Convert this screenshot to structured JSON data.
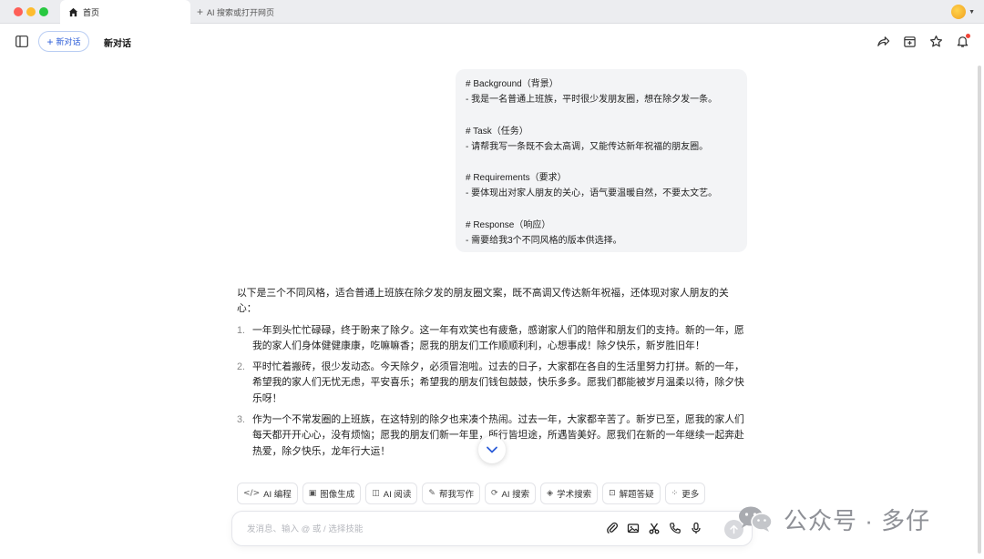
{
  "window": {
    "tabs": [
      {
        "label": "首页",
        "active": true
      },
      {
        "label": "AI 搜索或打开网页",
        "active": false
      }
    ]
  },
  "header": {
    "new_chat_label": "新对话",
    "title": "新对话"
  },
  "user_message": {
    "lines": [
      "# Background（背景）",
      "- 我是一名普通上班族，平时很少发朋友圈，想在除夕发一条。",
      "",
      "# Task（任务）",
      "- 请帮我写一条既不会太高调，又能传达新年祝福的朋友圈。",
      "",
      "# Requirements（要求）",
      "- 要体现出对家人朋友的关心，语气要温暖自然，不要太文艺。",
      "",
      "# Response（响应）",
      "- 需要给我3个不同风格的版本供选择。"
    ]
  },
  "answer": {
    "intro": "以下是三个不同风格，适合普通上班族在除夕发的朋友圈文案，既不高调又传达新年祝福，还体现对家人朋友的关心：",
    "items": [
      {
        "num": "1.",
        "text": "一年到头忙忙碌碌，终于盼来了除夕。这一年有欢笑也有疲惫，感谢家人们的陪伴和朋友们的支持。新的一年，愿我的家人们身体健健康康，吃嘛嘛香；愿我的朋友们工作顺顺利利，心想事成！除夕快乐，新岁胜旧年！"
      },
      {
        "num": "2.",
        "text": "平时忙着搬砖，很少发动态。今天除夕，必须冒泡啦。过去的日子，大家都在各自的生活里努力打拼。新的一年，希望我的家人们无忧无虑，平安喜乐；希望我的朋友们钱包鼓鼓，快乐多多。愿我们都能被岁月温柔以待，除夕快乐呀！"
      },
      {
        "num": "3.",
        "text": "作为一个不常发圈的上班族，在这特别的除夕也来凑个热闹。过去一年，大家都辛苦了。新岁已至，愿我的家人们每天都开开心心，没有烦恼；愿我的朋友们新一年里，所行皆坦途，所遇皆美好。愿我们在新的一年继续一起奔赴热爱，除夕快乐，龙年行大运！"
      }
    ]
  },
  "tools": [
    {
      "icon": "code-icon",
      "glyph": "</>",
      "label": "AI 编程"
    },
    {
      "icon": "image-icon",
      "glyph": "▣",
      "label": "图像生成"
    },
    {
      "icon": "read-icon",
      "glyph": "◫",
      "label": "AI 阅读"
    },
    {
      "icon": "write-icon",
      "glyph": "✎",
      "label": "帮我写作"
    },
    {
      "icon": "ai-search-icon",
      "glyph": "⟳",
      "label": "AI 搜索"
    },
    {
      "icon": "academic-icon",
      "glyph": "◈",
      "label": "学术搜索"
    },
    {
      "icon": "solve-icon",
      "glyph": "⊡",
      "label": "解题答疑"
    },
    {
      "icon": "more-icon",
      "glyph": "⁘",
      "label": "更多"
    }
  ],
  "input": {
    "placeholder": "发消息、输入 @ 或 / 选择技能"
  },
  "watermark": {
    "text": "公众号 · 多仔"
  },
  "colors": {
    "accent": "#2b5cd8",
    "bubble_bg": "#f3f4f6",
    "notification_dot": "#f04438"
  }
}
